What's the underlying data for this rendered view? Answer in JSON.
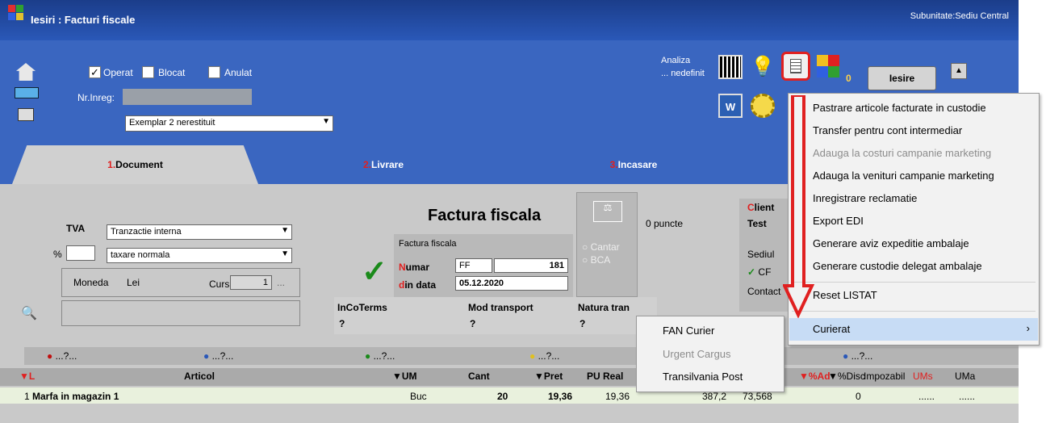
{
  "window": {
    "title": "Iesiri : Facturi fiscale",
    "subunitate": "Subunitate:Sediu Central"
  },
  "header": {
    "operat": "Operat",
    "blocat": "Blocat",
    "anulat": "Anulat",
    "nr_inreg_label": "Nr.Inreg:",
    "exemplar": "Exemplar 2 nerestituit",
    "analiza": "Analiza",
    "nedefinit": "... nedefinit",
    "counter": "0",
    "iesire": "Iesire"
  },
  "tabs": [
    {
      "num": "1.",
      "label": "Document"
    },
    {
      "num": "2.",
      "label": "Livrare"
    },
    {
      "num": "3.",
      "label": "Incasare"
    }
  ],
  "doc": {
    "tva": "TVA",
    "tranzactie": "Tranzactie interna",
    "pct": "%",
    "taxare": "taxare normala",
    "moneda": "Moneda",
    "lei": "Lei",
    "curs": "Curs",
    "curs_val": "1",
    "ellipsis": "...",
    "title": "Factura fiscala",
    "sub": "Factura fiscala",
    "numar_first": "N",
    "numar_rest": "umar",
    "serie": "FF",
    "nr": "181",
    "din_first": "d",
    "din_rest": "in data",
    "data": "05.12.2020",
    "cantar": "Cantar",
    "bca": "BCA",
    "puncte": "0 puncte",
    "client_first": "C",
    "client_rest": "lient",
    "client_name": "Test",
    "sediul": "Sediul",
    "cf": "CF",
    "contact": "Contact",
    "incoterms": "InCoTerms",
    "mod_transport": "Mod transport",
    "natura": "Natura tran",
    "q": "?"
  },
  "legend": [
    "...?...",
    "...?...",
    "...?...",
    "...?...",
    "...?..."
  ],
  "grid": {
    "headers": {
      "l": "L",
      "articol": "Articol",
      "um": "UM",
      "cant": "Cant",
      "pret": "Pret",
      "pureal": "PU Real",
      "ad": "%Ad",
      "disc": "%Disc",
      "impozabil": "Impozabil",
      "ums": "UMs",
      "uma": "UMa"
    },
    "row": {
      "nr": "1",
      "articol": "Marfa in magazin 1",
      "um": "Buc",
      "cant": "20",
      "pret": "19,36",
      "pureal": "19,36",
      "val": "387,2",
      "tva": "73,568",
      "impozabil": "0",
      "ums": "......",
      "uma": "......"
    }
  },
  "menu": [
    "Pastrare articole facturate in custodie",
    "Transfer pentru cont intermediar",
    "Adauga la costuri campanie marketing",
    "Adauga la venituri campanie marketing",
    "Inregistrare reclamatie",
    "Export EDI",
    "Generare aviz expeditie ambalaje",
    "Generare custodie delegat ambalaje",
    "Reset LISTAT",
    "Curierat"
  ],
  "submenu": [
    "FAN Curier",
    "Urgent Cargus",
    "Transilvania Post"
  ],
  "colors": {
    "accent_red": "#e02020",
    "highlight": "#c7dcf5"
  }
}
